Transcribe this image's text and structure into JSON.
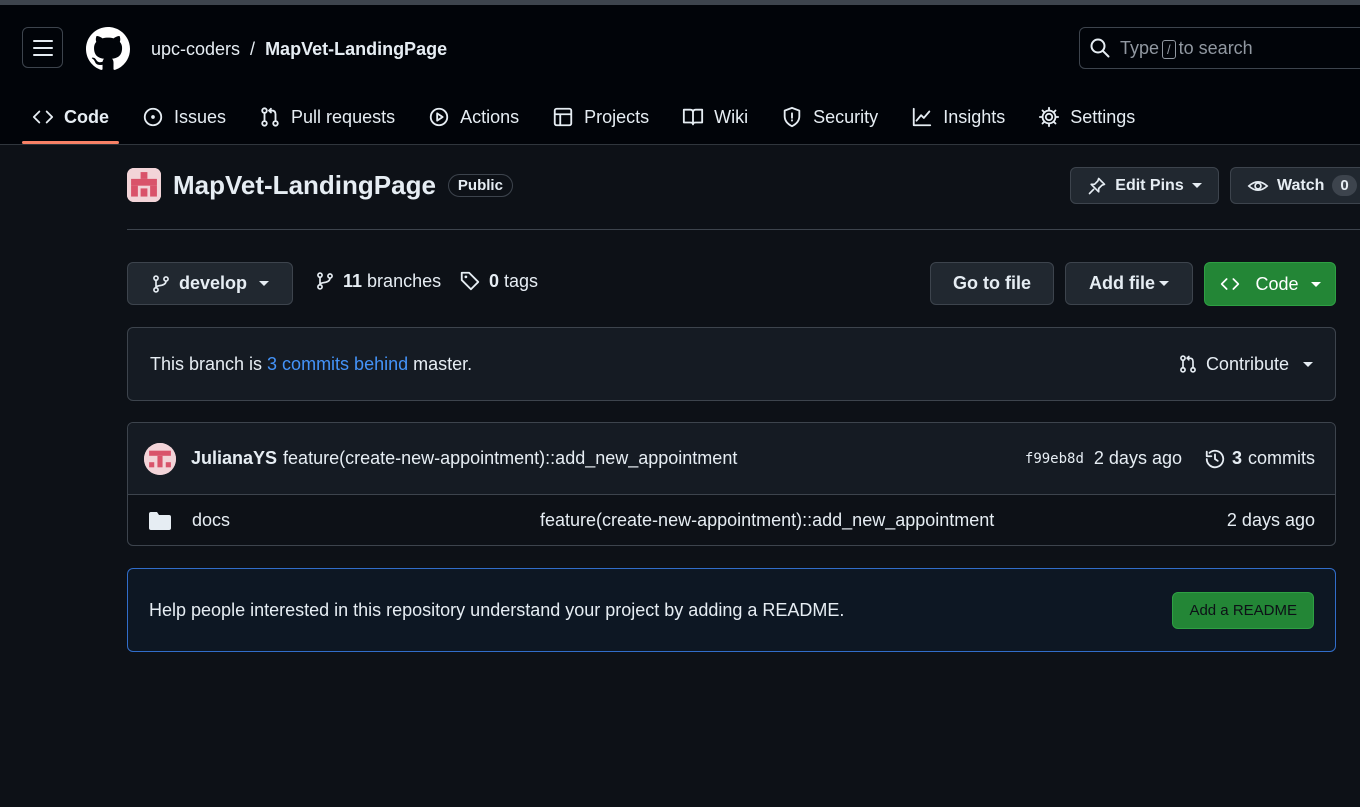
{
  "header": {
    "owner": "upc-coders",
    "separator": "/",
    "repo": "MapVet-LandingPage",
    "search": {
      "prefix": "Type",
      "key": "/",
      "suffix": "to search"
    }
  },
  "tabs": [
    {
      "label": "Code",
      "icon": "code-icon"
    },
    {
      "label": "Issues",
      "icon": "issue-icon"
    },
    {
      "label": "Pull requests",
      "icon": "pull-request-icon"
    },
    {
      "label": "Actions",
      "icon": "play-icon"
    },
    {
      "label": "Projects",
      "icon": "table-icon"
    },
    {
      "label": "Wiki",
      "icon": "book-icon"
    },
    {
      "label": "Security",
      "icon": "shield-icon"
    },
    {
      "label": "Insights",
      "icon": "graph-icon"
    },
    {
      "label": "Settings",
      "icon": "gear-icon"
    }
  ],
  "repo_header": {
    "title": "MapVet-LandingPage",
    "visibility": "Public",
    "edit_pins": "Edit Pins",
    "watch": "Watch",
    "watch_count": "0"
  },
  "branch_bar": {
    "branch": "develop",
    "branches_count": "11",
    "branches_label": "branches",
    "tags_count": "0",
    "tags_label": "tags",
    "go_to_file": "Go to file",
    "add_file": "Add file",
    "code": "Code"
  },
  "notice": {
    "prefix": "This branch is",
    "link": "3 commits behind",
    "suffix": "master.",
    "contribute": "Contribute"
  },
  "latest_commit": {
    "author": "JulianaYS",
    "message": "feature(create-new-appointment)::add_new_appointment",
    "sha": "f99eb8d",
    "age": "2 days ago",
    "commits_count": "3",
    "commits_label": "commits"
  },
  "files": [
    {
      "name": "docs",
      "message": "feature(create-new-appointment)::add_new_appointment",
      "age": "2 days ago"
    }
  ],
  "readme": {
    "text": "Help people interested in this repository understand your project by adding a README.",
    "button": "Add a README"
  },
  "colors": {
    "background": "#0d1117",
    "header": "#010409",
    "accent_underline": "#f78166",
    "link": "#4493f8",
    "green_button": "#238636"
  }
}
